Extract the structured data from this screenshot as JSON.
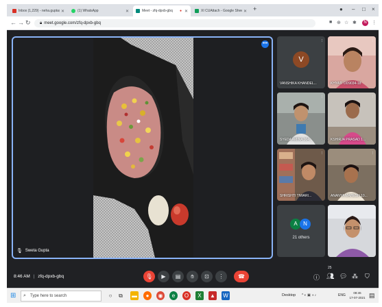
{
  "browser": {
    "tabs": [
      {
        "label": "Inbox (1,229) - neha.gupta@ind...",
        "favicon_color": "#d93025"
      },
      {
        "label": "(1) WhatsApp",
        "favicon_color": "#25d366"
      },
      {
        "label": "Meet - zfq-dpxb-gbq",
        "favicon_color": "#00897b"
      },
      {
        "label": "XI CUAttach - Google Sheets",
        "favicon_color": "#0f9d58"
      }
    ],
    "new_tab": "+",
    "window_controls": {
      "minimize": "–",
      "maximize": "□",
      "close": "×"
    },
    "url": "meet.google.com/zfq-dpxb-gbq",
    "profile_initial": "N"
  },
  "meet": {
    "presenter_name": "Sweta Gupta",
    "tile_menu": "•••",
    "participants": [
      {
        "name": "VANSHIKA KHANDEL...",
        "avatar": "V"
      },
      {
        "name": "KHYATI OD9034-18"
      },
      {
        "name": "SYEDA AMINA 004..."
      },
      {
        "name": "KSHIRJA PRASAD 1..."
      },
      {
        "name": "SHRISHTI TIWARI..."
      },
      {
        "name": "ANANYA MAHESH 10..."
      }
    ],
    "others": {
      "avatars": [
        "A",
        "N"
      ],
      "count_label": "21 others"
    },
    "time": "8:46 AM",
    "separator": "|",
    "meeting_code": "zfq-dpxb-gbq",
    "people_count": "25"
  },
  "taskbar": {
    "search_placeholder": "Type here to search",
    "desktop_label": "Desktop",
    "language": "ENG",
    "clock_time": "08:46",
    "clock_date": "17-07-2021"
  },
  "colors": {
    "meet_bg": "#202124",
    "tile_border": "#8ab4f8",
    "end_call": "#ea4335",
    "accent": "#1a73e8"
  }
}
